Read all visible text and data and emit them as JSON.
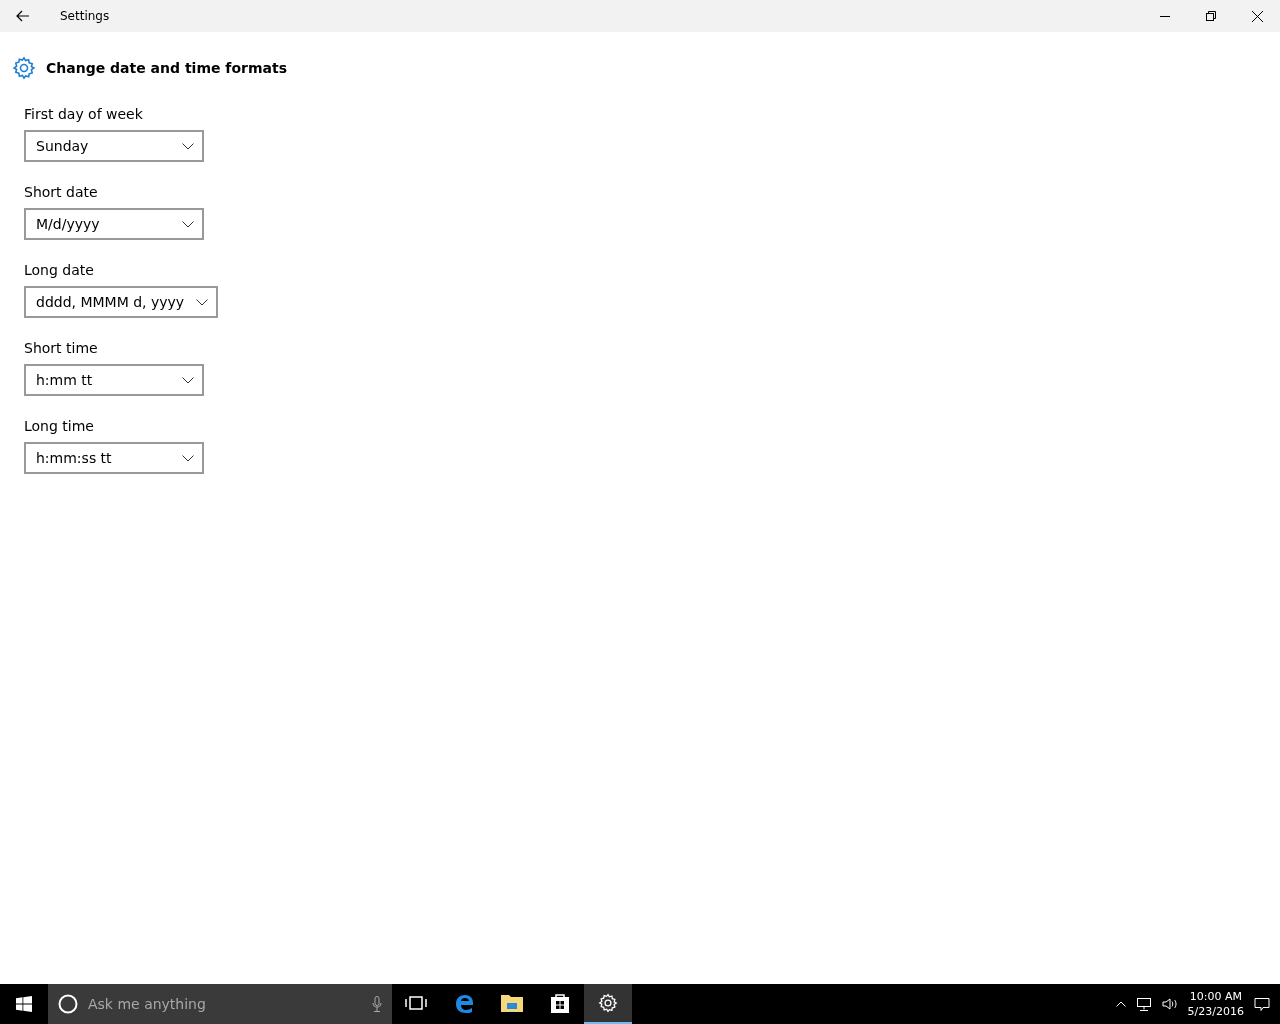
{
  "window": {
    "title": "Settings"
  },
  "heading": "Change date and time formats",
  "fields": [
    {
      "label": "First day of week",
      "value": "Sunday"
    },
    {
      "label": "Short date",
      "value": "M/d/yyyy"
    },
    {
      "label": "Long date",
      "value": "dddd, MMMM d, yyyy"
    },
    {
      "label": "Short time",
      "value": "h:mm tt"
    },
    {
      "label": "Long time",
      "value": "h:mm:ss tt"
    }
  ],
  "taskbar": {
    "search": {
      "placeholder": "Ask me anything"
    },
    "apps": [
      {
        "kind": "taskview",
        "selected": false
      },
      {
        "kind": "browser",
        "selected": false
      },
      {
        "kind": "folder",
        "selected": false
      },
      {
        "kind": "store",
        "selected": false
      },
      {
        "kind": "settings",
        "selected": true
      }
    ],
    "time": "10:00 AM",
    "date": "5/23/2016"
  }
}
